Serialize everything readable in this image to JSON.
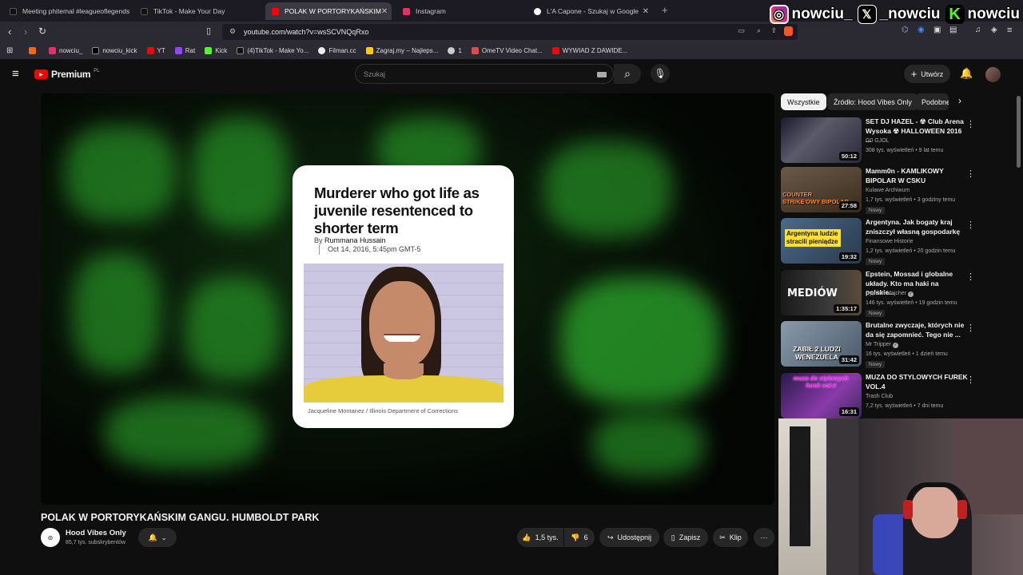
{
  "tabs": [
    {
      "label": "Meeting phitemal #leagueoflegends",
      "color": "#000"
    },
    {
      "label": "TikTok - Make Your Day",
      "color": "#000"
    },
    {
      "label": "POLAK W PORTORYKAŃSKIM",
      "color": "#ff0000"
    },
    {
      "label": "Instagram",
      "color": "#e1306c"
    },
    {
      "label": "L'A Capone - Szukaj w Google",
      "color": "#4285f4"
    }
  ],
  "social": {
    "instagram": "nowciu_",
    "x": "_nowciu",
    "kick": "nowciu"
  },
  "address": {
    "url": "youtube.com/watch?v=wsSCVNQqRxo"
  },
  "bookmarks": [
    "",
    "nowciu_",
    "nowciu_kick",
    "YT",
    "Rat",
    "Kick",
    "(4)TikTok - Make Yo...",
    "Filman.cc",
    "Zagraj.my – Najleps...",
    "1",
    "OmeTV Video Chat...",
    "WYWIAD Z DAWIDE..."
  ],
  "yt": {
    "logo": "Premium",
    "region": "PL",
    "search_placeholder": "Szukaj",
    "create": "Utwórz"
  },
  "card": {
    "headline": "Murderer who got life as juvenile resentenced to shorter term",
    "by": "By",
    "author": "Rummana Hussain",
    "date": "Oct 14, 2016, 5:45pm GMT-5",
    "caption": "Jacqueline Montanez / Illinois Department of Corrections"
  },
  "video": {
    "title": "POLAK W PORTORYKAŃSKIM GANGU. HUMBOLDT PARK",
    "channel": "Hood Vibes Only",
    "subs": "85,7 tys. subskrybentów",
    "likes": "1,5 tys.",
    "dislikes": "6",
    "share": "Udostępnij",
    "save": "Zapisz",
    "clip": "Klip"
  },
  "chips": [
    "Wszystkie",
    "Źródło: Hood Vibes Only",
    "Podobne"
  ],
  "recommendations": [
    {
      "title": "SET DJ HAZEL - ☢ Club Arena Wysoka ☢ HALLOWEEN 2016 ...",
      "channel": "G0 GJOL",
      "meta": "308 tys. wyświetleń • 9 lat temu",
      "duration": "50:12",
      "badge": "",
      "thumb_text": ""
    },
    {
      "title": "Mamm0n - KAMLIKOWY BIPOLAR W CSKU",
      "channel": "Kulawe Archiwum",
      "meta": "1,7 tys. wyświetleń • 3 godziny temu",
      "duration": "27:58",
      "badge": "Nowy",
      "thumb_text": "COUNTER STRIKE'OWY BIPOLAR"
    },
    {
      "title": "Argentyna. Jak bogaty kraj zniszczył własną gospodarkę",
      "channel": "Finansowe Historie",
      "meta": "1,2 tys. wyświetleń • 20 godzin temu",
      "duration": "19:32",
      "badge": "Nowy",
      "thumb_text": "Argentyna ludzie stracili pieniądze"
    },
    {
      "title": "Epstein, Mossad i globalne układy. Kto ma haki na polskie...",
      "channel": "Cyprian Majcher",
      "meta": "146 tys. wyświetleń • 19 godzin temu",
      "duration": "1:35:17",
      "badge": "Nowy",
      "thumb_text": "MEDIÓW"
    },
    {
      "title": "Brutalne zwyczaje, których nie da się zapomnieć. Tego nie ...",
      "channel": "Mr Tripper",
      "meta": "16 tys. wyświetleń • 1 dzień temu",
      "duration": "31:42",
      "badge": "Nowy",
      "thumb_text": "ZABIŁ 2 LUDZI WENEZUELA"
    },
    {
      "title": "MUZA DO STYLOWYCH FUREK VOL.4",
      "channel": "Trash Club",
      "meta": "7,2 tys. wyświetleń • 7 dni temu",
      "duration": "16:31",
      "badge": "",
      "thumb_text": "muza do stylowych furek vol.4"
    }
  ]
}
